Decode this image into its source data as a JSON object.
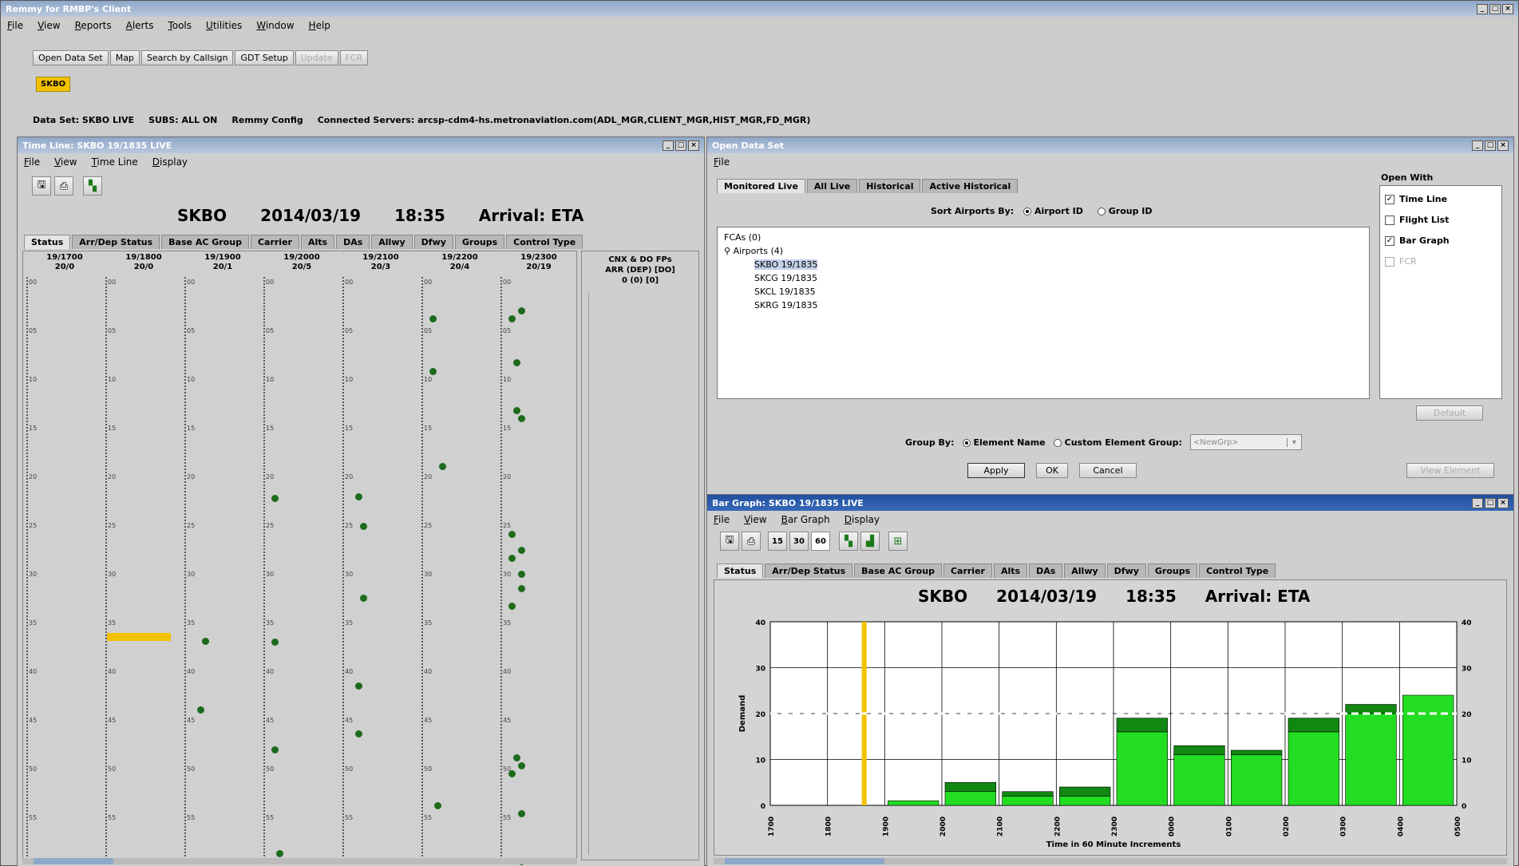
{
  "app": {
    "title": "Remmy for RMBP's Client"
  },
  "menu": [
    "File",
    "View",
    "Reports",
    "Alerts",
    "Tools",
    "Utilities",
    "Window",
    "Help"
  ],
  "toolbar": {
    "buttons": [
      "Open Data Set",
      "Map",
      "Search by Callsign",
      "GDT Setup",
      "Update",
      "FCR"
    ],
    "airport_tag": "SKBO"
  },
  "status_line": {
    "dataset": "Data Set: SKBO LIVE",
    "subs": "SUBS: ALL ON",
    "config": "Remmy Config",
    "servers": "Connected Servers: arcsp-cdm4-hs.metronaviation.com(ADL_MGR,CLIENT_MGR,HIST_MGR,FD_MGR)"
  },
  "timeline": {
    "window_title": "Time Line: SKBO 19/1835 LIVE",
    "menu": [
      "File",
      "View",
      "Time Line",
      "Display"
    ],
    "header": {
      "airport": "SKBO",
      "date": "2014/03/19",
      "time": "18:35",
      "mode": "Arrival: ETA"
    },
    "tabs": [
      "Status",
      "Arr/Dep Status",
      "Base AC Group",
      "Carrier",
      "Alts",
      "DAs",
      "Allwy",
      "Dfwy",
      "Groups",
      "Control Type"
    ],
    "columns": [
      {
        "t": "19/1700",
        "c": "20/0"
      },
      {
        "t": "19/1800",
        "c": "20/0"
      },
      {
        "t": "19/1900",
        "c": "20/1"
      },
      {
        "t": "19/2000",
        "c": "20/5"
      },
      {
        "t": "19/2100",
        "c": "20/3"
      },
      {
        "t": "19/2200",
        "c": "20/4"
      },
      {
        "t": "19/2300",
        "c": "20/19"
      }
    ],
    "side_header": [
      "CNX & DO FPs",
      "ARR (DEP) [DO]",
      "0 (0) [0]"
    ],
    "minute_labels": [
      "00",
      "05",
      "10",
      "15",
      "20",
      "25",
      "30",
      "35",
      "40",
      "45",
      "50",
      "55"
    ]
  },
  "open_dataset": {
    "window_title": "Open Data Set",
    "menu": [
      "File"
    ],
    "tabs": [
      "Monitored Live",
      "All Live",
      "Historical",
      "Active Historical"
    ],
    "sort_label": "Sort Airports By:",
    "sort_opts": [
      "Airport ID",
      "Group ID"
    ],
    "tree": {
      "fcas": "FCAs (0)",
      "airports": "Airports (4)",
      "items": [
        "SKBO 19/1835",
        "SKCG 19/1835",
        "SKCL 19/1835",
        "SKRG 19/1835"
      ]
    },
    "open_with_title": "Open With",
    "open_with": [
      {
        "label": "Time Line",
        "checked": true
      },
      {
        "label": "Flight List",
        "checked": false
      },
      {
        "label": "Bar Graph",
        "checked": true
      },
      {
        "label": "FCR",
        "checked": false,
        "disabled": true
      }
    ],
    "default_btn": "Default",
    "group_by_label": "Group By:",
    "group_opts": [
      "Element Name",
      "Custom Element Group:"
    ],
    "group_select": "<NewGrp>",
    "buttons": [
      "Apply",
      "OK",
      "Cancel"
    ],
    "view_element_btn": "View Element"
  },
  "bargraph": {
    "window_title": "Bar Graph: SKBO 19/1835 LIVE",
    "menu": [
      "File",
      "View",
      "Bar Graph",
      "Display"
    ],
    "intervals": [
      "15",
      "30",
      "60"
    ],
    "tabs": [
      "Status",
      "Arr/Dep Status",
      "Base AC Group",
      "Carrier",
      "Alts",
      "DAs",
      "Allwy",
      "Dfwy",
      "Groups",
      "Control Type"
    ],
    "header": {
      "airport": "SKBO",
      "date": "2014/03/19",
      "time": "18:35",
      "mode": "Arrival: ETA"
    },
    "ylabel": "Demand",
    "xlabel": "Time in 60 Minute Increments"
  },
  "chart_data": {
    "type": "bar",
    "categories": [
      "1700",
      "1800",
      "1900",
      "2000",
      "2100",
      "2200",
      "2300",
      "0000",
      "0100",
      "0200",
      "0300",
      "0400",
      "0500"
    ],
    "series": [
      {
        "values": [
          0,
          0,
          1,
          3,
          2,
          2,
          16,
          11,
          11,
          16,
          20,
          24
        ]
      },
      {
        "values": [
          0,
          0,
          0,
          2,
          1,
          2,
          3,
          2,
          1,
          3,
          2,
          0
        ]
      }
    ],
    "ylim": [
      0,
      40
    ],
    "yticks": [
      0,
      10,
      20,
      30,
      40
    ],
    "rate_line": 20,
    "current_time_position": "between 1800 and 1900",
    "colors": {
      "bar": "#22dd22",
      "bar_top": "#118811",
      "rate": "#ffffff",
      "now": "#f2c200"
    }
  }
}
